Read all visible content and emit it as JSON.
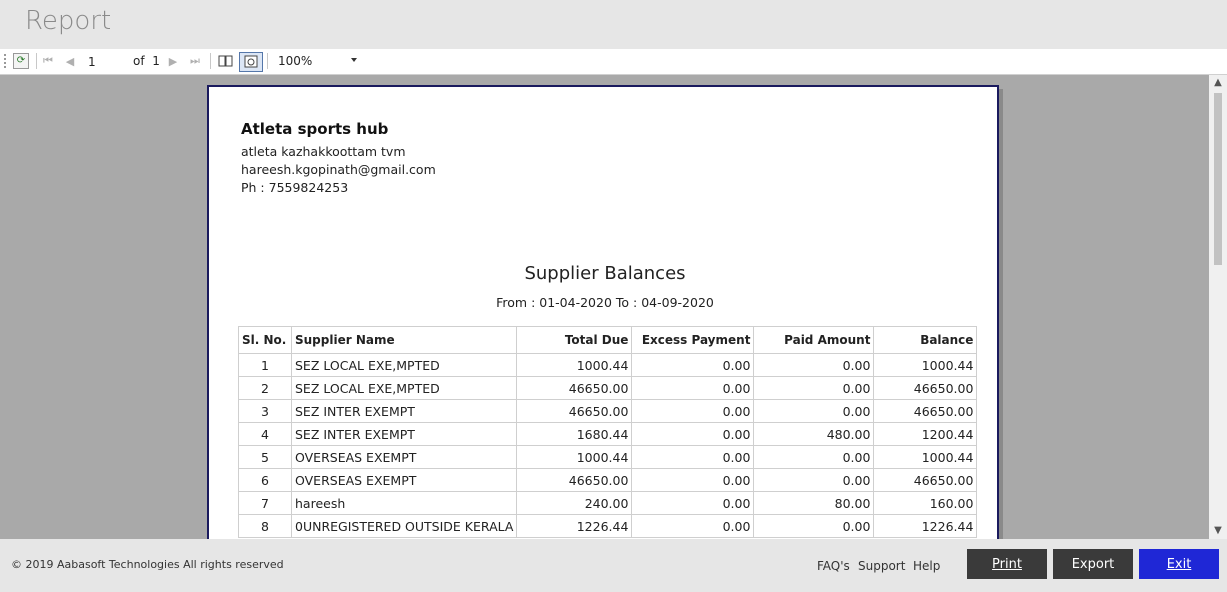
{
  "window": {
    "title": "Report"
  },
  "toolbar": {
    "page_value": "1",
    "of_label": "of",
    "total_pages": "1",
    "zoom": "100%"
  },
  "report": {
    "company": "Atleta sports hub",
    "address": "atleta kazhakkoottam tvm",
    "email": "hareesh.kgopinath@gmail.com",
    "phone": "Ph : 7559824253",
    "title": "Supplier Balances",
    "range": "From : 01-04-2020 To : 04-09-2020",
    "columns": [
      "Sl. No.",
      "Supplier Name",
      "Total Due",
      "Excess Payment",
      "Paid Amount",
      "Balance"
    ],
    "rows": [
      [
        "1",
        "SEZ LOCAL EXE,MPTED",
        "1000.44",
        "0.00",
        "0.00",
        "1000.44"
      ],
      [
        "2",
        "SEZ LOCAL EXE,MPTED",
        "46650.00",
        "0.00",
        "0.00",
        "46650.00"
      ],
      [
        "3",
        "SEZ INTER EXEMPT",
        "46650.00",
        "0.00",
        "0.00",
        "46650.00"
      ],
      [
        "4",
        "SEZ INTER EXEMPT",
        "1680.44",
        "0.00",
        "480.00",
        "1200.44"
      ],
      [
        "5",
        "OVERSEAS EXEMPT",
        "1000.44",
        "0.00",
        "0.00",
        "1000.44"
      ],
      [
        "6",
        "OVERSEAS EXEMPT",
        "46650.00",
        "0.00",
        "0.00",
        "46650.00"
      ],
      [
        "7",
        "hareesh",
        "240.00",
        "0.00",
        "80.00",
        "160.00"
      ],
      [
        "8",
        "0UNREGISTERED OUTSIDE KERALA",
        "1226.44",
        "0.00",
        "0.00",
        "1226.44"
      ]
    ]
  },
  "footer": {
    "copyright": "© 2019 Aabasoft Technologies All rights reserved",
    "faq": "FAQ's",
    "support": "Support",
    "help": "Help",
    "print": "Print",
    "export": "Export",
    "exit": "Exit"
  },
  "colors": {
    "accent": "#1f27d6",
    "dark_button": "#3a3a3a",
    "paper_border": "#1a1a5e"
  }
}
